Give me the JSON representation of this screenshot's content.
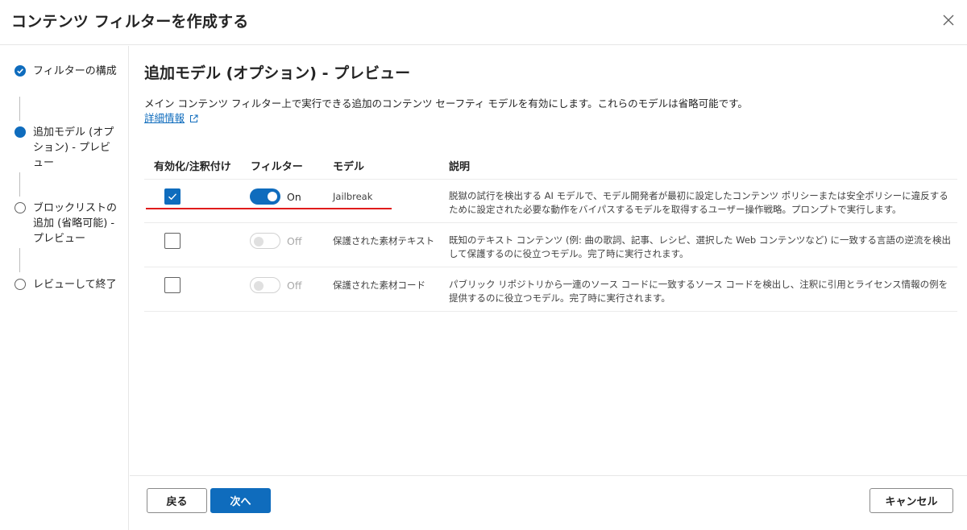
{
  "dialog": {
    "title": "コンテンツ フィルターを作成する"
  },
  "steps": [
    {
      "label": "フィルターの構成",
      "state": "done"
    },
    {
      "label": "追加モデル (オプション) - プレビュー",
      "state": "current"
    },
    {
      "label": "ブロックリストの追加 (省略可能) - プレビュー",
      "state": "todo"
    },
    {
      "label": "レビューして終了",
      "state": "todo"
    }
  ],
  "main": {
    "title": "追加モデル (オプション) - プレビュー",
    "description": "メイン コンテンツ フィルター上で実行できる追加のコンテンツ セーフティ モデルを有効にします。これらのモデルは省略可能です。",
    "learn_more": "詳細情報"
  },
  "table": {
    "headers": {
      "enable": "有効化/注釈付け",
      "filter": "フィルター",
      "model": "モデル",
      "description": "説明"
    },
    "rows": [
      {
        "checked": true,
        "toggle": "On",
        "model": "Jailbreak",
        "description": "脱獄の試行を検出する AI モデルで、モデル開発者が最初に設定したコンテンツ ポリシーまたは安全ポリシーに違反するために設定された必要な動作をバイパスするモデルを取得するユーザー操作戦略。プロンプトで実行します。"
      },
      {
        "checked": false,
        "toggle": "Off",
        "model": "保護された素材テキスト",
        "description": "既知のテキスト コンテンツ (例: 曲の歌詞、記事、レシピ、選択した Web コンテンツなど) に一致する言語の逆流を検出して保護するのに役立つモデル。完了時に実行されます。"
      },
      {
        "checked": false,
        "toggle": "Off",
        "model": "保護された素材コード",
        "description": "パブリック リポジトリから一連のソース コードに一致するソース コードを検出し、注釈に引用とライセンス情報の例を提供するのに役立つモデル。完了時に実行されます。"
      }
    ]
  },
  "footer": {
    "back": "戻る",
    "next": "次へ",
    "cancel": "キャンセル"
  },
  "colors": {
    "accent": "#0f6cbd",
    "annotation_underline": "#e01b1b"
  }
}
